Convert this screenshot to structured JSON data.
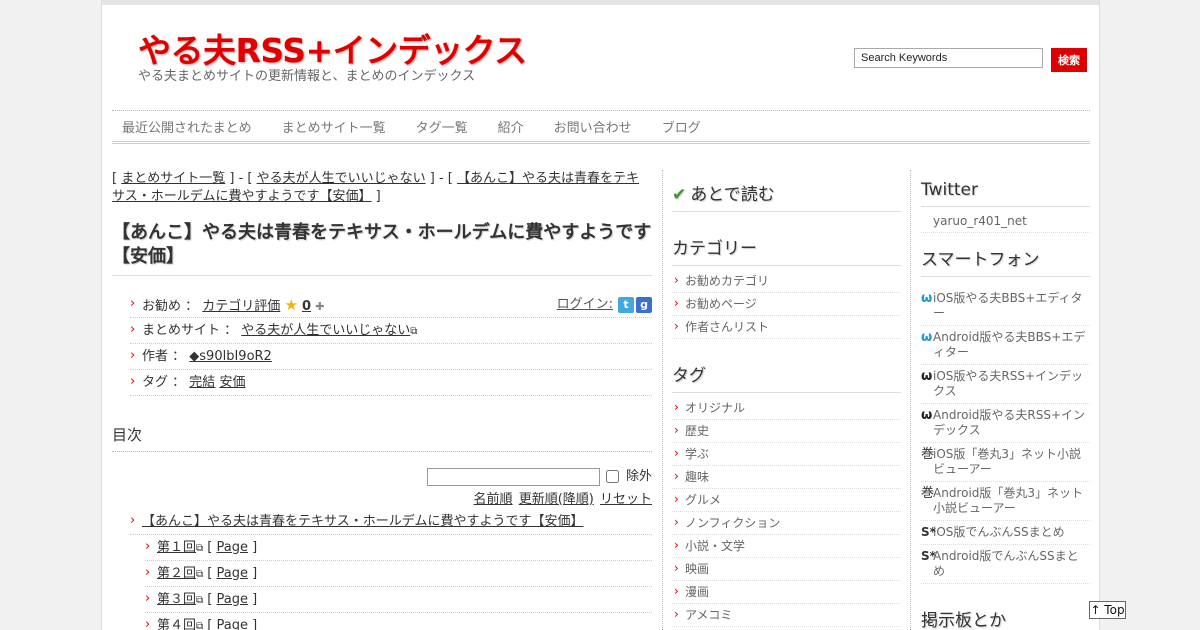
{
  "header": {
    "site_title": "やる夫RSS+インデックス",
    "site_subtitle": "やる夫まとめサイトの更新情報と、まとめのインデックス",
    "search_placeholder": "Search Keywords",
    "search_button": "検索"
  },
  "nav": [
    "最近公開されたまとめ",
    "まとめサイト一覧",
    "タグ一覧",
    "紹介",
    "お問い合わせ",
    "ブログ"
  ],
  "breadcrumb": {
    "open1": "[",
    "link1": "まとめサイト一覧",
    "sep1": "] - [",
    "link2": "やる夫が人生でいいじゃない",
    "sep2": "] - [",
    "link3": "【あんこ】やる夫は青春をテキサス・ホールデムに費やすようです【安価】",
    "close": "]"
  },
  "article": {
    "title": "【あんこ】やる夫は青春をテキサス・ホールデムに費やすようです【安価】",
    "rec_label": "お勧め ：",
    "rec_link": "カテゴリ評価",
    "rec_count": "0",
    "plus": "✚",
    "login_label": "ログイン:",
    "site_label": "まとめサイト ：",
    "site_link": "やる夫が人生でいいじゃない",
    "author_label": "作者 ：",
    "author_link": "◆s90lbI9oR2",
    "tags_label": "タグ ：",
    "tags": [
      "完結",
      "安価"
    ]
  },
  "toc": {
    "title": "目次",
    "exclude_label": "除外",
    "sort_name": "名前順",
    "sort_updated": "更新順(降順)",
    "reset": "リセット",
    "main_item": "【あんこ】やる夫は青春をテキサス・ホールデムに費やすようです【安価】",
    "page_open": "[",
    "page_label": "Page",
    "page_close": "]",
    "items": [
      "第１回",
      "第２回",
      "第３回",
      "第４回"
    ]
  },
  "sidebar_mid": {
    "read_later": "あとで読む",
    "category_title": "カテゴリー",
    "categories": [
      "お勧めカテゴリ",
      "お勧めページ",
      "作者さんリスト"
    ],
    "tag_title": "タグ",
    "tags": [
      "オリジナル",
      "歴史",
      "学ぶ",
      "趣味",
      "グルメ",
      "ノンフィクション",
      "小説・文学",
      "映画",
      "漫画",
      "アメコミ"
    ]
  },
  "sidebar_right": {
    "twitter_title": "Twitter",
    "twitter_account": "yaruo_r401_net",
    "smartphone_title": "スマートフォン",
    "apps": [
      {
        "icon": "ω",
        "label": "iOS版やる夫BBS+エディター"
      },
      {
        "icon": "ω",
        "label": "Android版やる夫BBS+エディター"
      },
      {
        "icon": "ω",
        "label": "iOS版やる夫RSS+インデックス"
      },
      {
        "icon": "ω",
        "label": "Android版やる夫RSS+インデックス"
      },
      {
        "icon": "巻",
        "label": "iOS版「巻丸3」ネット小説ビューアー"
      },
      {
        "icon": "巻",
        "label": "Android版「巻丸3」ネット小説ビューアー"
      },
      {
        "icon": "S*",
        "label": "iOS版でんぶんSSまとめ"
      },
      {
        "icon": "S*",
        "label": "Android版でんぶんSSまとめ"
      }
    ],
    "board_title": "掲示板とか"
  },
  "top_button": "↑ Top",
  "colors": {
    "brand_red": "#e00000",
    "accent_red": "#dd0000",
    "bullet_red": "#dd0000",
    "omega_blue": "#1a9ad6",
    "check_green": "#3a9a2a"
  },
  "icons": [
    "star-icon",
    "twitter-icon",
    "google-icon",
    "external-link-icon",
    "check-icon"
  ]
}
